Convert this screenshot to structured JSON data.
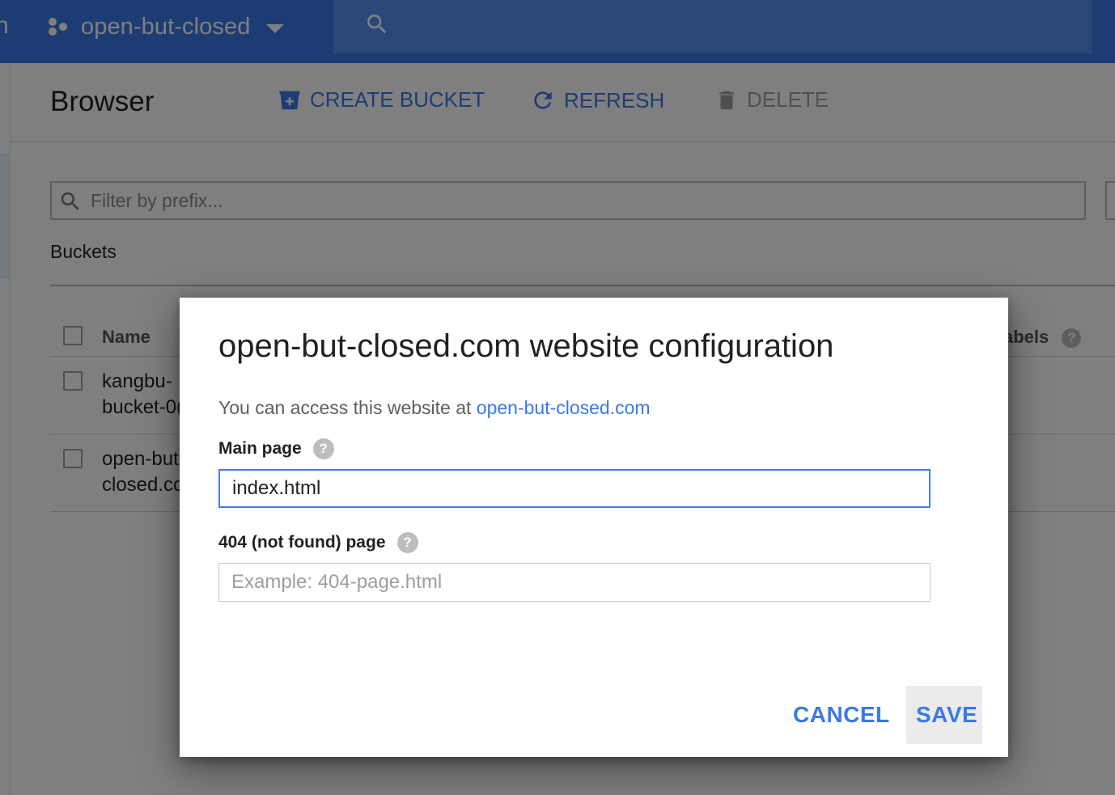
{
  "header": {
    "project_name": "open-but-closed",
    "edge_glyph": "n"
  },
  "toolbar": {
    "title": "Browser",
    "create_bucket": "CREATE BUCKET",
    "refresh": "REFRESH",
    "delete": "DELETE"
  },
  "filter": {
    "placeholder": "Filter by prefix..."
  },
  "buckets": {
    "section_label": "Buckets",
    "columns": {
      "name": "Name",
      "labels": "abels"
    },
    "rows": [
      {
        "name_line1": "kangbu-",
        "name_line2": "bucket-0("
      },
      {
        "name_line1": "open-but",
        "name_line2": "closed.cc"
      }
    ]
  },
  "dialog": {
    "title": "open-but-closed.com website configuration",
    "description": "You can access this website at ",
    "link": "open-but-closed.com",
    "main_page": {
      "label": "Main page",
      "value": "index.html"
    },
    "not_found_page": {
      "label": "404 (not found) page",
      "value": "",
      "placeholder": "Example: 404-page.html"
    },
    "help_glyph": "?",
    "cancel": "CANCEL",
    "save": "SAVE"
  },
  "colors": {
    "header_bg": "#3b78e7",
    "accent": "#3b78e7",
    "focus_border": "#4a7de0",
    "scrim": "rgba(0,0,0,0.5)"
  },
  "icons": [
    "project-dots-icon",
    "chevron-down-icon",
    "search-icon",
    "create-bucket-icon",
    "refresh-icon",
    "trash-icon",
    "help-icon"
  ]
}
